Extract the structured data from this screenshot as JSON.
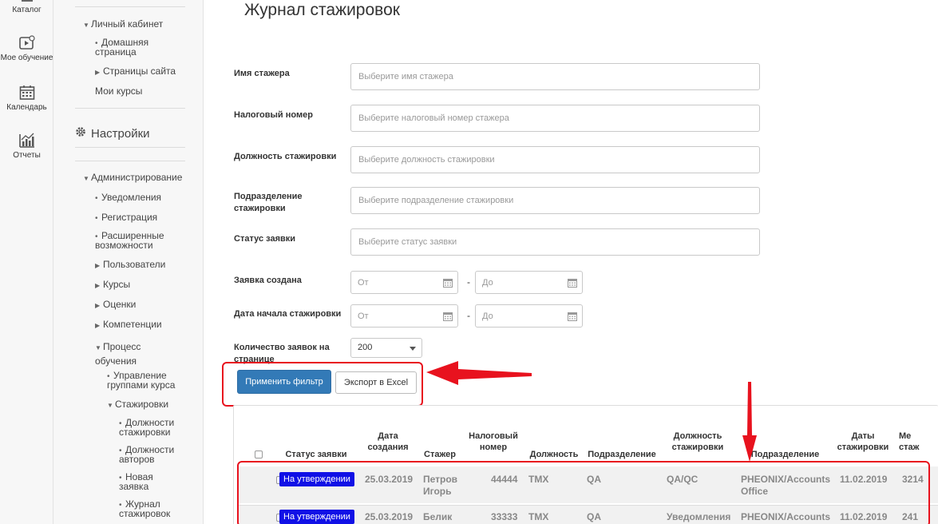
{
  "rail": {
    "items": [
      {
        "label": "Каталог",
        "icon": "catalog-icon"
      },
      {
        "label": "Мое обучение",
        "icon": "play-book-icon"
      },
      {
        "label": "Календарь",
        "icon": "calendar-icon"
      },
      {
        "label": "Отчеты",
        "icon": "chart-icon"
      }
    ]
  },
  "sidebar": {
    "personal": "Личный кабинет",
    "home_page": "Домашняя страница",
    "site_pages": "Страницы сайта",
    "my_courses": "Мои курсы",
    "settings": "Настройки",
    "admin": "Администрирование",
    "notifications": "Уведомления",
    "registration": "Регистрация",
    "advanced": "Расширенные возможности",
    "users": "Пользователи",
    "courses": "Курсы",
    "grades": "Оценки",
    "competencies": "Компетенции",
    "process": "Процесс обучения",
    "group_mgmt": "Управление группами курса",
    "internships": "Стажировки",
    "intern_positions": "Должности стажировки",
    "author_positions": "Должности авторов",
    "new_request": "Новая заявка",
    "journal": "Журнал стажировок"
  },
  "page": {
    "title": "Журнал стажировок"
  },
  "filters": {
    "intern_name_label": "Имя стажера",
    "intern_name_placeholder": "Выберите имя стажера",
    "tax_label": "Налоговый номер",
    "tax_placeholder": "Выберите налоговый номер стажера",
    "position_label": "Должность стажировки",
    "position_placeholder": "Выберите должность стажировки",
    "dept_label": "Подразделение стажировки",
    "dept_placeholder": "Выберите подразделение стажировки",
    "status_label": "Статус заявки",
    "status_placeholder": "Выберите статус заявки",
    "created_label": "Заявка создана",
    "start_label": "Дата начала стажировки",
    "from_placeholder": "От",
    "to_placeholder": "До",
    "dash": "-",
    "per_page_label": "Количество заявок на странице",
    "per_page_value": "200"
  },
  "buttons": {
    "apply": "Применить фильтр",
    "export": "Экспорт в Excel"
  },
  "table": {
    "headers": {
      "status": "Статус заявки",
      "created": "Дата создания",
      "intern": "Стажер",
      "tax": "Налоговый номер",
      "position": "Должность",
      "dept": "Подразделение",
      "intern_position": "Должность стажировки",
      "intern_dept": "Подразделение",
      "dates": "Даты стажировки",
      "extra": "Ме стаж"
    },
    "rows": [
      {
        "status": "На утверждении",
        "created": "25.03.2019",
        "intern": "Петров Игорь",
        "tax": "44444",
        "position": "TMX",
        "dept": "QA",
        "intern_position": "QA/QC",
        "intern_dept": "PHEONIX/Accounts Office",
        "dates": "11.02.2019",
        "extra": "3214"
      },
      {
        "status": "На утверждении",
        "created": "25.03.2019",
        "intern": "Белик",
        "tax": "33333",
        "position": "TMX",
        "dept": "QA",
        "intern_position": "Уведомления",
        "intern_dept": "PHEONIX/Accounts",
        "dates": "11.02.2019",
        "extra": "241"
      }
    ]
  },
  "colors": {
    "primary": "#337ab7",
    "badge": "#1010e6",
    "highlight": "#e8121e"
  }
}
